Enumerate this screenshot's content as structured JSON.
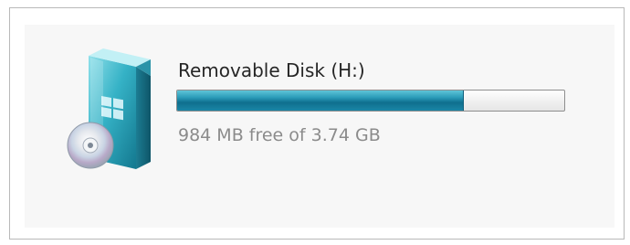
{
  "drive": {
    "icon": "removable-disk-icon",
    "name": "Removable Disk (H:)",
    "space_text": "984 MB free of 3.74 GB",
    "used_fraction": 0.74,
    "bar_color": "#1a86a6"
  }
}
